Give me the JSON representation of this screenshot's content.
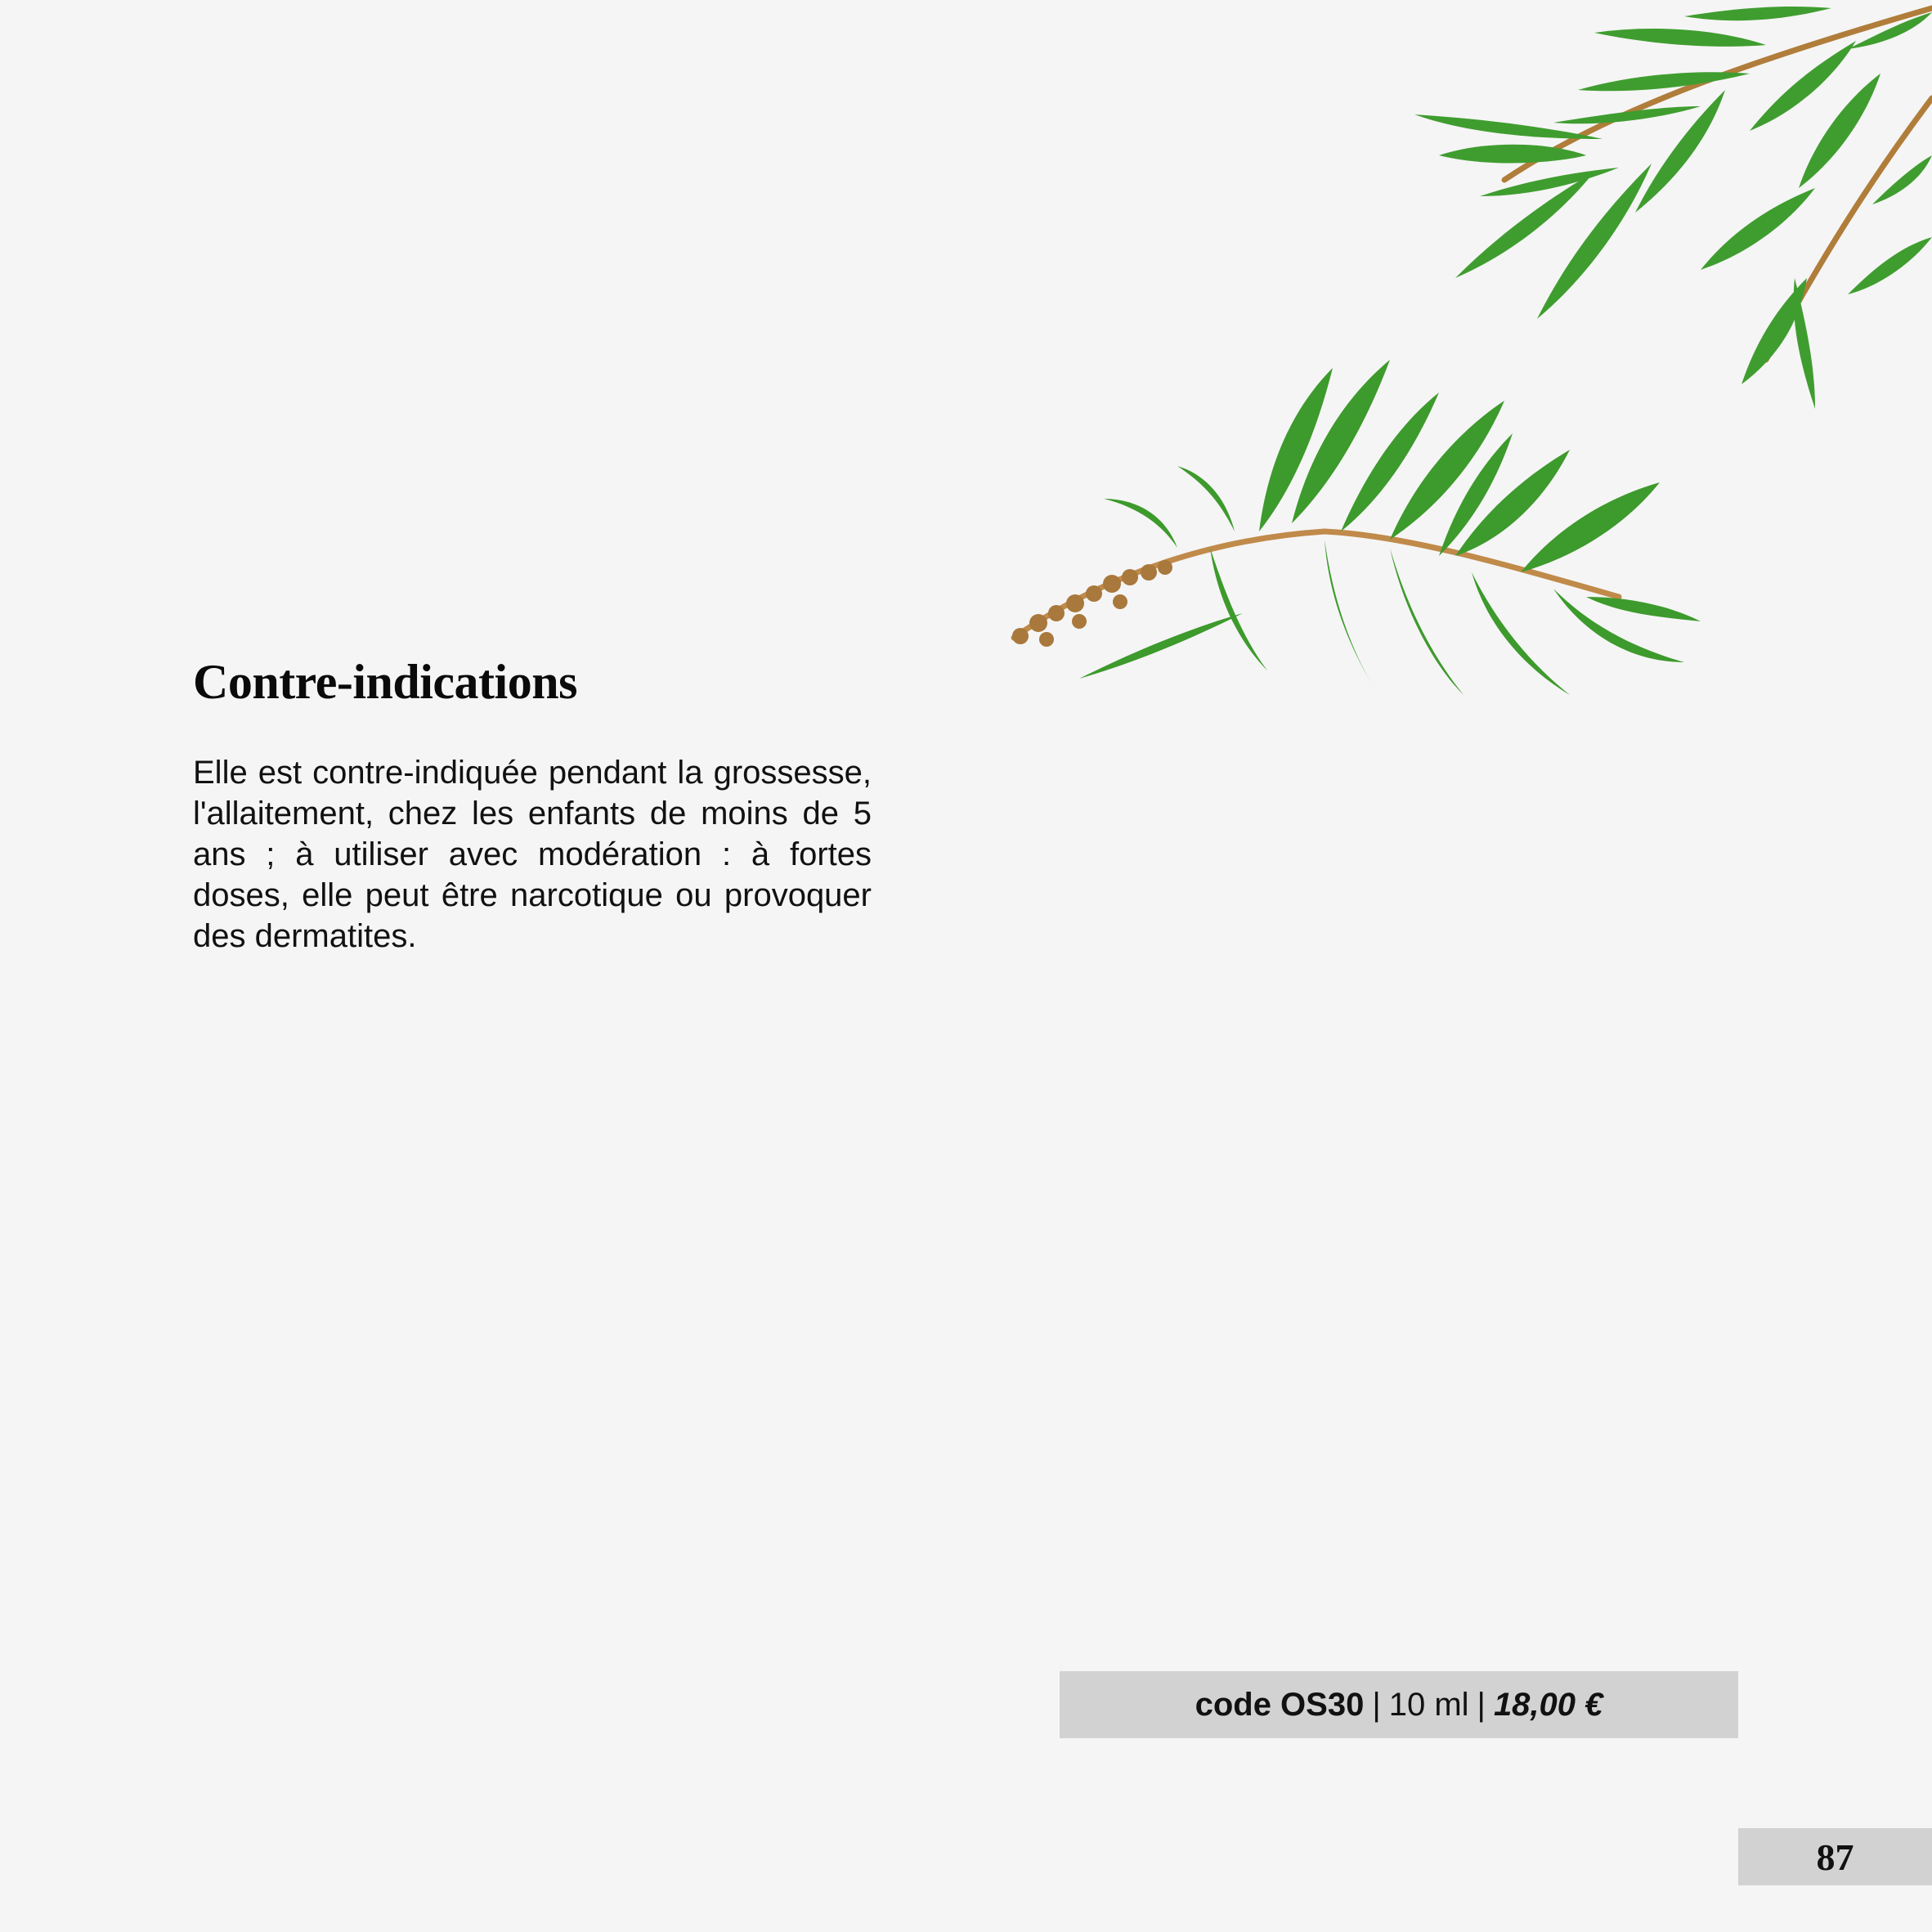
{
  "section": {
    "heading": "Contre-indications",
    "body": "Elle est contre-indiquée pendant la grossesse, l'allaitement, chez les enfants de moins de 5 ans ; à utiliser avec modération : à fortes doses, elle peut être narcotique ou provoquer des dermatites."
  },
  "product": {
    "code": "code OS30",
    "volume": "10 ml",
    "separator": "|",
    "price": "18,00 €"
  },
  "page": {
    "number": "87"
  },
  "images": {
    "top_right": "tea-tree-sprig-icon",
    "middle": "tea-tree-branch-with-seeds-icon"
  },
  "colors": {
    "background": "#f5f5f5",
    "bar": "#d2d2d2",
    "leaf": "#3e9a2e",
    "stem": "#b88a4a"
  }
}
